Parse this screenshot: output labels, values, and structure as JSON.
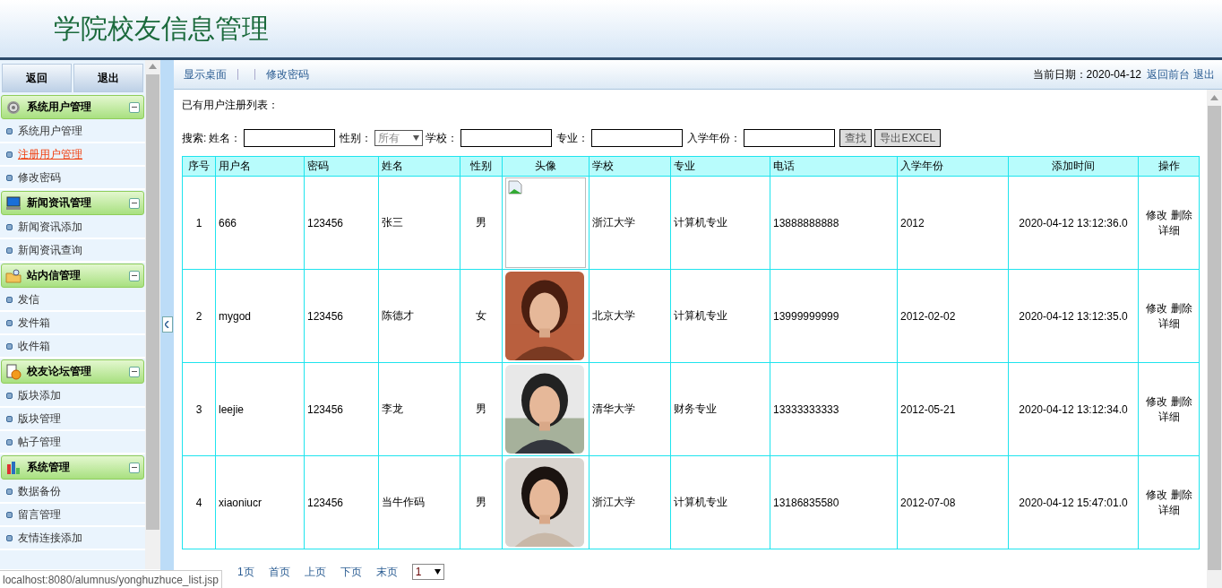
{
  "header": {
    "title": "学院校友信息管理"
  },
  "sidebar": {
    "buttons": [
      "返回",
      "退出"
    ],
    "sections": [
      {
        "title": "系统用户管理",
        "expanded": true,
        "items": [
          {
            "label": "系统用户管理",
            "selected": false
          },
          {
            "label": "注册用户管理",
            "selected": true
          },
          {
            "label": "修改密码",
            "selected": false
          }
        ]
      },
      {
        "title": "新闻资讯管理",
        "expanded": true,
        "items": [
          {
            "label": "新闻资讯添加",
            "selected": false
          },
          {
            "label": "新闻资讯查询",
            "selected": false
          }
        ]
      },
      {
        "title": "站内信管理",
        "expanded": true,
        "items": [
          {
            "label": "发信",
            "selected": false
          },
          {
            "label": "发件箱",
            "selected": false
          },
          {
            "label": "收件箱",
            "selected": false
          }
        ]
      },
      {
        "title": "校友论坛管理",
        "expanded": true,
        "items": [
          {
            "label": "版块添加",
            "selected": false
          },
          {
            "label": "版块管理",
            "selected": false
          },
          {
            "label": "帖子管理",
            "selected": false
          }
        ]
      },
      {
        "title": "系统管理",
        "expanded": true,
        "items": [
          {
            "label": "数据备份",
            "selected": false
          },
          {
            "label": "留言管理",
            "selected": false
          },
          {
            "label": "友情连接添加",
            "selected": false
          }
        ]
      }
    ]
  },
  "toolbar": {
    "links": [
      "显示桌面",
      "修改密码"
    ],
    "date_label": "当前日期：2020-04-12",
    "right_links": [
      "返回前台",
      "退出"
    ]
  },
  "content": {
    "heading": "已有用户注册列表：",
    "search": {
      "label": "搜索:",
      "fields": [
        {
          "label": "姓名：",
          "kind": "text"
        },
        {
          "label": "性别：",
          "kind": "select",
          "value": "所有"
        },
        {
          "label": "学校：",
          "kind": "text"
        },
        {
          "label": "专业：",
          "kind": "text"
        },
        {
          "label": "入学年份：",
          "kind": "text"
        }
      ],
      "buttons": [
        "查找",
        "导出EXCEL"
      ]
    },
    "table": {
      "columns": [
        "序号",
        "用户名",
        "密码",
        "姓名",
        "性别",
        "头像",
        "学校",
        "专业",
        "电话",
        "入学年份",
        "添加时间",
        "操作"
      ],
      "rows": [
        {
          "cells": [
            "1",
            "666",
            "123456",
            "张三",
            "男"
          ],
          "avatar": {
            "kind": "broken"
          },
          "cells_after": [
            "浙江大学",
            "计算机专业",
            "13888888888",
            "2012",
            "2020-04-12 13:12:36.0"
          ],
          "actions": [
            "修改",
            "删除",
            "详细"
          ]
        },
        {
          "cells": [
            "2",
            "mygod",
            "123456",
            "陈德才",
            "女"
          ],
          "avatar": {
            "kind": "picture"
          },
          "cells_after": [
            "北京大学",
            "计算机专业",
            "13999999999",
            "2012-02-02",
            "2020-04-12 13:12:35.0"
          ],
          "actions": [
            "修改",
            "删除",
            "详细"
          ]
        },
        {
          "cells": [
            "3",
            "leejie",
            "123456",
            "李龙",
            "男"
          ],
          "avatar": {
            "kind": "picture"
          },
          "cells_after": [
            "清华大学",
            "财务专业",
            "13333333333",
            "2012-05-21",
            "2020-04-12 13:12:34.0"
          ],
          "actions": [
            "修改",
            "删除",
            "详细"
          ]
        },
        {
          "cells": [
            "4",
            "xiaoniucr",
            "123456",
            "当牛作码",
            "男"
          ],
          "avatar": {
            "kind": "picture"
          },
          "cells_after": [
            "浙江大学",
            "计算机专业",
            "13186835580",
            "2012-07-08",
            "2020-04-12 15:47:01.0"
          ],
          "actions": [
            "修改",
            "删除",
            "详细"
          ]
        }
      ]
    },
    "pagination": {
      "text": "1页",
      "links": [
        "首页",
        "上页",
        "下页",
        "末页"
      ],
      "page_select": "1"
    }
  },
  "status_bar": {
    "url": "localhost:8080/alumnus/yonghuzhuce_list.jsp"
  }
}
